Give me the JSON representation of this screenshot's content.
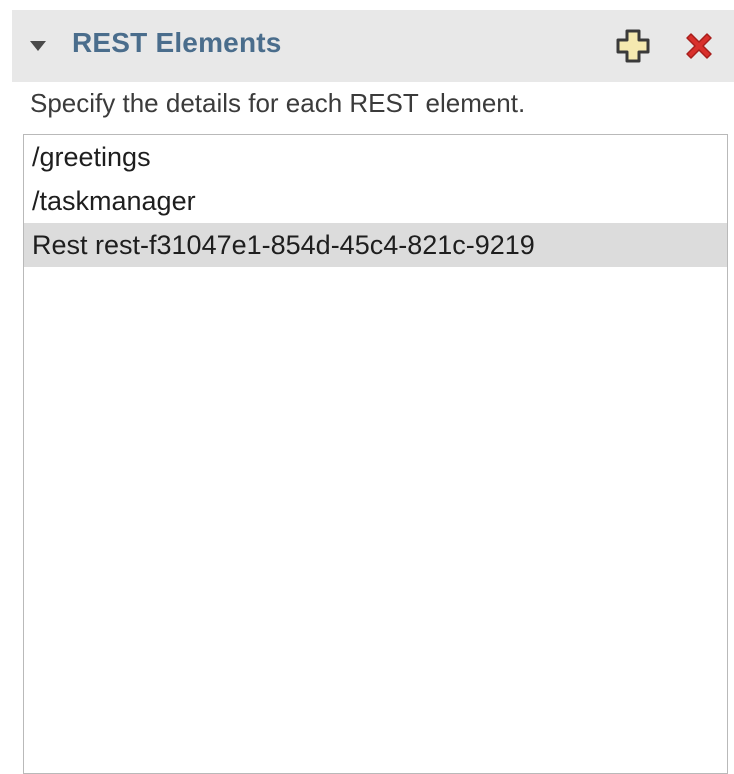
{
  "section": {
    "title": "REST Elements",
    "toggle_icon": "triangle-down-icon",
    "add_icon": "plus-icon",
    "remove_icon": "red-x-icon",
    "description": "Specify the details for each REST element."
  },
  "list": {
    "items": [
      {
        "label": "/greetings",
        "selected": false
      },
      {
        "label": "/taskmanager",
        "selected": false
      },
      {
        "label": "Rest rest-f31047e1-854d-45c4-821c-9219",
        "selected": true
      }
    ]
  },
  "colors": {
    "header_bg": "#e8e8e8",
    "title": "#4a6d8c",
    "remove": "#d9302c",
    "add_fill": "#f5e9b0",
    "selected_bg": "#dcdcdc"
  }
}
